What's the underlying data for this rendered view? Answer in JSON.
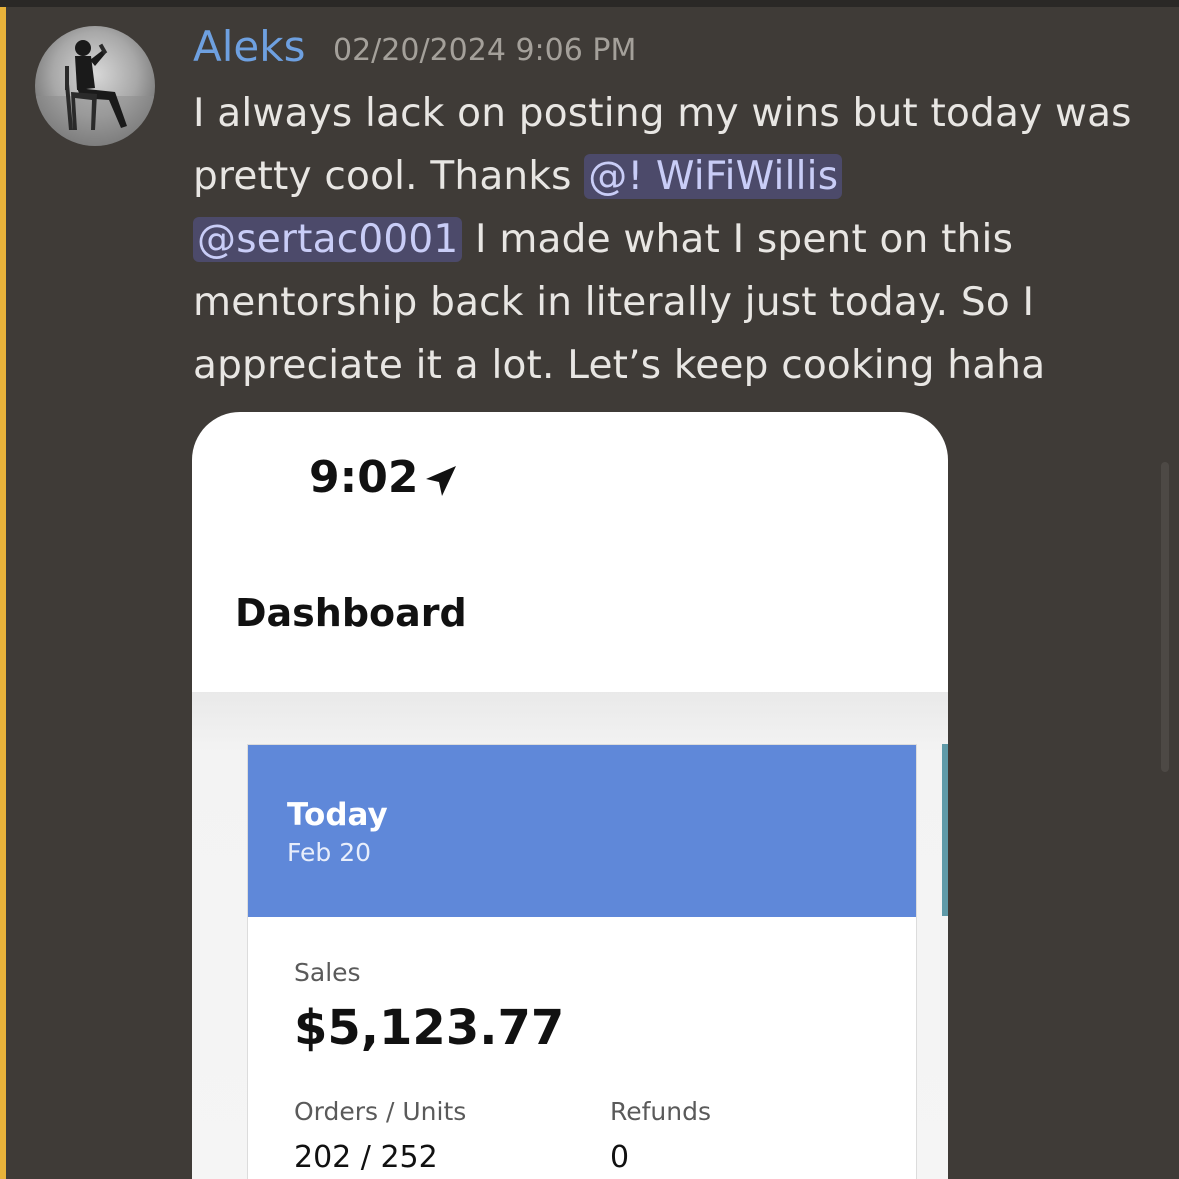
{
  "message": {
    "author": "Aleks",
    "timestamp": "02/20/2024 9:06 PM",
    "author_color": "#6ea0e0",
    "lines": {
      "l1": "I always lack on posting my wins but today was",
      "l2_pre": "pretty cool. Thanks ",
      "mention1": "@! WiFiWillis",
      "mention2": "@sertac0001",
      "l3_post": " I made what I spent on this",
      "l4": "mentorship back in literally just today. So I",
      "l5": "appreciate it a lot. Let’s keep cooking haha"
    }
  },
  "attachment": {
    "status_time": "9:02",
    "status_icon": "location-arrow-icon",
    "page_title": "Dashboard",
    "card": {
      "period": "Today",
      "date": "Feb 20",
      "header_color": "#5f88d9",
      "sales_label": "Sales",
      "sales_value": "$5,123.77",
      "orders_label": "Orders / Units",
      "orders_value": "202 / 252",
      "refunds_label": "Refunds",
      "refunds_value": "0"
    }
  },
  "colors": {
    "background": "#3f3b37",
    "mention_bg": "#4c4a6a",
    "mention_text": "#c9cdf7",
    "new_message_bar": "#e8b23a"
  }
}
